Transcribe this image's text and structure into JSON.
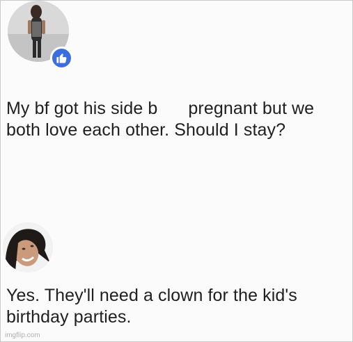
{
  "post": {
    "text_before_censor": "My bf got his side b",
    "text_after_censor": "pregnant but we both love each other. Should I stay?"
  },
  "reply": {
    "text": "Yes. They'll need a clown for the kid's birthday parties."
  },
  "like_badge": {
    "icon": "thumbs-up-icon",
    "color": "#3b6fe0"
  },
  "watermark": "imgflip.com"
}
